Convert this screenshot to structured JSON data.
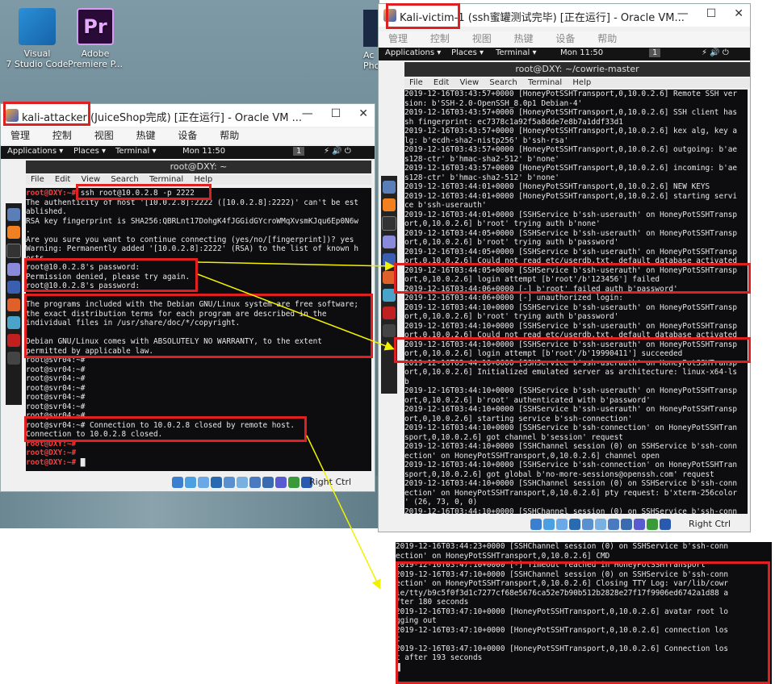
{
  "desktop": {
    "icons": [
      {
        "label": "Visual Studio Code",
        "display": "Visual\n7 Studio Code"
      },
      {
        "label": "Adobe Premiere P...",
        "display": "Adobe\nPremiere P..."
      }
    ],
    "partial_icon_label": "Ac\nPhot"
  },
  "attacker_window": {
    "title": "kali-attacker (JuiceShop完成) [正在运行] - Oracle VM ...",
    "menu": [
      "管理",
      "控制",
      "视图",
      "热键",
      "设备",
      "帮助"
    ],
    "gnome": {
      "applications": "Applications ▾",
      "places": "Places ▾",
      "terminal": "Terminal ▾",
      "time": "Mon 11:50",
      "workspace": "1"
    },
    "term_title": "root@DXY: ~",
    "term_menu": [
      "File",
      "Edit",
      "View",
      "Search",
      "Terminal",
      "Help"
    ],
    "lines": [
      {
        "p": "root@DXY:~# ",
        "t": "ssh root@10.0.2.8 -p 2222"
      },
      {
        "p": "",
        "t": "The authenticity of host '[10.0.2.8]:2222 ([10.0.2.8]:2222)' can't be est"
      },
      {
        "p": "",
        "t": "ablished."
      },
      {
        "p": "",
        "t": "RSA key fingerprint is SHA256:QBRLnt17DohgK4fJGGidGYcroWMqXvsmKJqu6Ep0N6w"
      },
      {
        "p": "",
        "t": "."
      },
      {
        "p": "",
        "t": "Are you sure you want to continue connecting (yes/no/[fingerprint])? yes"
      },
      {
        "p": "",
        "t": "Warning: Permanently added '[10.0.2.8]:2222' (RSA) to the list of known h"
      },
      {
        "p": "",
        "t": "osts."
      },
      {
        "p": "",
        "t": "root@10.0.2.8's password:"
      },
      {
        "p": "",
        "t": "Permission denied, please try again."
      },
      {
        "p": "",
        "t": "root@10.0.2.8's password:"
      },
      {
        "p": "",
        "t": ""
      },
      {
        "p": "",
        "t": "The programs included with the Debian GNU/Linux system are free software;"
      },
      {
        "p": "",
        "t": "the exact distribution terms for each program are described in the"
      },
      {
        "p": "",
        "t": "individual files in /usr/share/doc/*/copyright."
      },
      {
        "p": "",
        "t": ""
      },
      {
        "p": "",
        "t": "Debian GNU/Linux comes with ABSOLUTELY NO WARRANTY, to the extent"
      },
      {
        "p": "",
        "t": "permitted by applicable law."
      },
      {
        "p": "",
        "t": "root@svr04:~#"
      },
      {
        "p": "",
        "t": "root@svr04:~#"
      },
      {
        "p": "",
        "t": "root@svr04:~#"
      },
      {
        "p": "",
        "t": "root@svr04:~#"
      },
      {
        "p": "",
        "t": "root@svr04:~#"
      },
      {
        "p": "",
        "t": "root@svr04:~#"
      },
      {
        "p": "",
        "t": "root@svr04:~#"
      },
      {
        "p": "",
        "t": "root@svr04:~# Connection to 10.0.2.8 closed by remote host."
      },
      {
        "p": "",
        "t": "Connection to 10.0.2.8 closed."
      },
      {
        "p": "root@DXY:~# ",
        "t": ""
      },
      {
        "p": "root@DXY:~# ",
        "t": ""
      },
      {
        "p": "root@DXY:~# ",
        "t": "█"
      }
    ],
    "host_key": "Right Ctrl"
  },
  "victim_window": {
    "title": "Kali-victim-1 (ssh蜜罐测试完毕) [正在运行] - Oracle VM...",
    "menu": [
      "管理",
      "控制",
      "视图",
      "热键",
      "设备",
      "帮助"
    ],
    "gnome": {
      "applications": "Applications ▾",
      "places": "Places ▾",
      "terminal": "Terminal ▾",
      "time": "Mon 11:50",
      "workspace": "1"
    },
    "term_title": "root@DXY: ~/cowrie-master",
    "term_menu": [
      "File",
      "Edit",
      "View",
      "Search",
      "Terminal",
      "Help"
    ],
    "lines": [
      "2019-12-16T03:43:57+0000 [HoneyPotSSHTransport,0,10.0.2.6] Remote SSH ver",
      "sion: b'SSH-2.0-OpenSSH_8.0p1 Debian-4'",
      "2019-12-16T03:43:57+0000 [HoneyPotSSHTransport,0,10.0.2.6] SSH client has",
      "sh fingerprint: ec7378c1a92f5a8dde7e8b7a1ddf33d1",
      "2019-12-16T03:43:57+0000 [HoneyPotSSHTransport,0,10.0.2.6] kex alg, key a",
      "lg: b'ecdh-sha2-nistp256' b'ssh-rsa'",
      "2019-12-16T03:43:57+0000 [HoneyPotSSHTransport,0,10.0.2.6] outgoing: b'ae",
      "s128-ctr' b'hmac-sha2-512' b'none'",
      "2019-12-16T03:43:57+0000 [HoneyPotSSHTransport,0,10.0.2.6] incoming: b'ae",
      "s128-ctr' b'hmac-sha2-512' b'none'",
      "2019-12-16T03:44:01+0000 [HoneyPotSSHTransport,0,10.0.2.6] NEW KEYS",
      "2019-12-16T03:44:01+0000 [HoneyPotSSHTransport,0,10.0.2.6] starting servi",
      "ce b'ssh-userauth'",
      "2019-12-16T03:44:01+0000 [SSHService b'ssh-userauth' on HoneyPotSSHTransp",
      "ort,0,10.0.2.6] b'root' trying auth b'none'",
      "2019-12-16T03:44:05+0000 [SSHService b'ssh-userauth' on HoneyPotSSHTransp",
      "ort,0,10.0.2.6] b'root' trying auth b'password'",
      "2019-12-16T03:44:05+0000 [SSHService b'ssh-userauth' on HoneyPotSSHTransp",
      "ort,0,10.0.2.6] Could not read etc/userdb.txt, default database activated",
      "2019-12-16T03:44:05+0000 [SSHService b'ssh-userauth' on HoneyPotSSHTransp",
      "ort,0,10.0.2.6] login attempt [b'root'/b'123456'] failed",
      "2019-12-16T03:44:06+0000 [-] b'root' failed auth b'password'",
      "2019-12-16T03:44:06+0000 [-] unauthorized login:",
      "2019-12-16T03:44:10+0000 [SSHService b'ssh-userauth' on HoneyPotSSHTransp",
      "ort,0,10.0.2.6] b'root' trying auth b'password'",
      "2019-12-16T03:44:10+0000 [SSHService b'ssh-userauth' on HoneyPotSSHTransp",
      "ort,0,10.0.2.6] Could not read etc/userdb.txt, default database activated",
      "2019-12-16T03:44:10+0000 [SSHService b'ssh-userauth' on HoneyPotSSHTransp",
      "ort,0,10.0.2.6] login attempt [b'root'/b'19990411'] succeeded",
      "2019-12-16T03:44:10+0000 [SSHService b'ssh-userauth' on HoneyPotSSHTransp",
      "ort,0,10.0.2.6] Initialized emulated server as architecture: linux-x64-ls",
      "b",
      "2019-12-16T03:44:10+0000 [SSHService b'ssh-userauth' on HoneyPotSSHTransp",
      "ort,0,10.0.2.6] b'root' authenticated with b'password'",
      "2019-12-16T03:44:10+0000 [SSHService b'ssh-userauth' on HoneyPotSSHTransp",
      "ort,0,10.0.2.6] starting service b'ssh-connection'",
      "2019-12-16T03:44:10+0000 [SSHService b'ssh-connection' on HoneyPotSSHTran",
      "sport,0,10.0.2.6] got channel b'session' request",
      "2019-12-16T03:44:10+0000 [SSHChannel session (0) on SSHService b'ssh-conn",
      "ection' on HoneyPotSSHTransport,0,10.0.2.6] channel open",
      "2019-12-16T03:44:10+0000 [SSHService b'ssh-connection' on HoneyPotSSHTran",
      "sport,0,10.0.2.6] got global b'no-more-sessions@openssh.com' request",
      "2019-12-16T03:44:10+0000 [SSHChannel session (0) on SSHService b'ssh-conn",
      "ection' on HoneyPotSSHTransport,0,10.0.2.6] pty request: b'xterm-256color",
      "' (26, 73, 0, 0)",
      "2019-12-16T03:44:10+0000 [SSHChannel session (0) on SSHService b'ssh-conn"
    ],
    "host_key": "Right Ctrl"
  },
  "log_panel": {
    "lines": [
      "2019-12-16T03:44:23+0000 [SSHChannel session (0) on SSHService b'ssh-conn",
      "ection' on HoneyPotSSHTransport,0,10.0.2.6] CMD",
      "2019-12-16T03:47:10+0000 [-] Timeout reached in HoneyPotSSHTransport",
      "2019-12-16T03:47:10+0000 [SSHChannel session (0) on SSHService b'ssh-conn",
      "ection' on HoneyPotSSHTransport,0,10.0.2.6] Closing TTY Log: var/lib/cowr",
      "ie/tty/b9c5f0f3d1c7277cf68e5676ca52e7b90b512b2828e27f17f9906ed6742a1d88 a",
      "fter 180 seconds",
      "2019-12-16T03:47:10+0000 [HoneyPotSSHTransport,0,10.0.2.6] avatar root lo",
      "gging out",
      "2019-12-16T03:47:10+0000 [HoneyPotSSHTransport,0,10.0.2.6] connection los",
      "t",
      "2019-12-16T03:47:10+0000 [HoneyPotSSHTransport,0,10.0.2.6] Connection los",
      "t after 193 seconds",
      "█"
    ]
  },
  "colors": {
    "annotation_red": "#e02020",
    "arrow_yellow": "#f2f200",
    "prompt_red": "#ff3b3b",
    "terminal_bg": "#0d0d0f"
  }
}
